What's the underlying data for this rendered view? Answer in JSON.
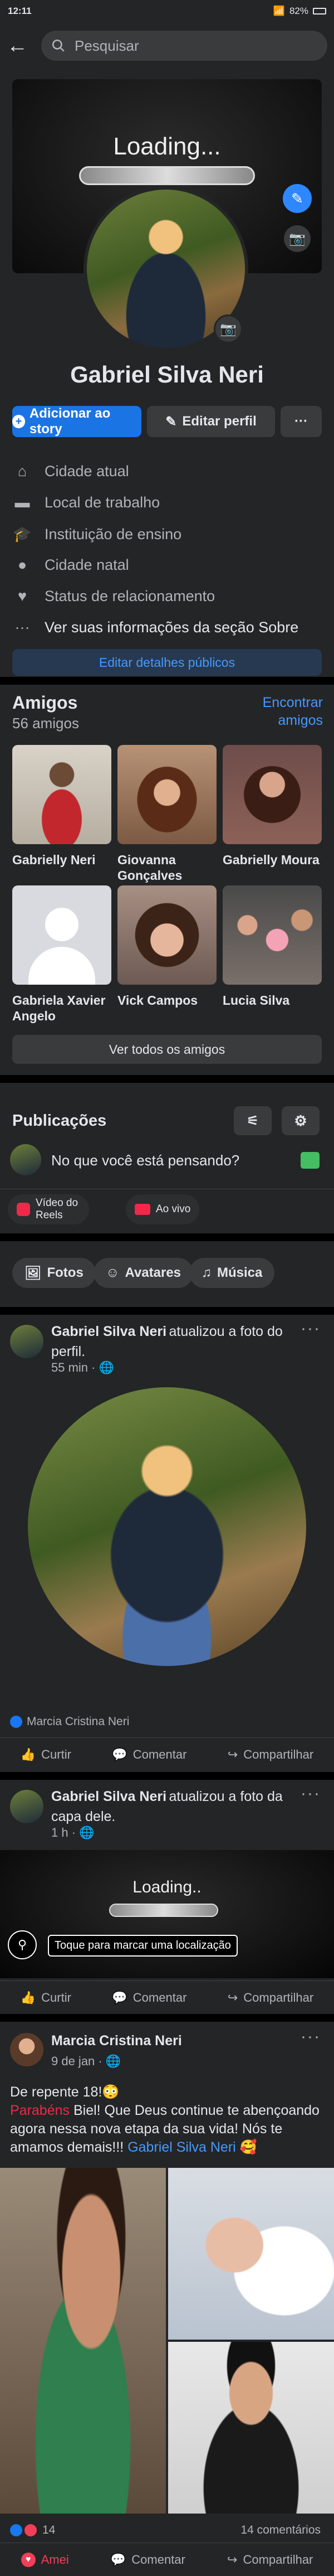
{
  "status": {
    "time": "12:11",
    "battery": "82%"
  },
  "search": {
    "placeholder": "Pesquisar"
  },
  "profile": {
    "cover_text": "Loading...",
    "name": "Gabriel Silva Neri",
    "add_story": "Adicionar ao story",
    "edit_profile": "Editar perfil",
    "more": "···"
  },
  "about": {
    "items": [
      "Cidade atual",
      "Local de trabalho",
      "Instituição de ensino",
      "Cidade natal",
      "Status de relacionamento"
    ],
    "see_more": "Ver suas informações da seção Sobre",
    "edit_public": "Editar detalhes públicos"
  },
  "friends": {
    "title": "Amigos",
    "count": "56 amigos",
    "find": "Encontrar amigos",
    "list": [
      "Gabrielly Neri",
      "Giovanna Gonçalves",
      "Gabrielly Moura",
      "Gabriela Xavier Angelo",
      "Vick Campos",
      "Lucia Silva"
    ],
    "see_all": "Ver todos os amigos"
  },
  "publications": {
    "title": "Publicações",
    "composer": "No que você está pensando?",
    "reels": "Vídeo do Reels",
    "live": "Ao vivo"
  },
  "filters": {
    "photos": "Fotos",
    "avatars": "Avatares",
    "music": "Música"
  },
  "posts": [
    {
      "author": "Gabriel Silva Neri",
      "action": "atualizou a foto do perfil.",
      "time": "55 min",
      "reactor": "Marcia Cristina Neri"
    },
    {
      "author": "Gabriel Silva Neri",
      "action": "atualizou a foto da capa dele.",
      "time": "1 h",
      "cover_text": "Loading..",
      "location_tip": "Toque para marcar uma localização"
    },
    {
      "author": "Marcia Cristina Neri",
      "time": "9 de jan",
      "text_1": "De repente 18!😳",
      "highlight": "Parabéns",
      "text_2": " Biel! Que Deus continue te abençoando agora nessa nova etapa da sua vida! Nós te amamos demais!!! ",
      "mention": "Gabriel Silva Neri",
      "emoji": " 🥰",
      "reactions": "14",
      "comments": "14 comentários"
    }
  ],
  "actions": {
    "like": "Curtir",
    "comment": "Comentar",
    "share": "Compartilhar",
    "loved": "Amei"
  },
  "colors": {
    "bg": "#18191a",
    "card": "#242526",
    "accent": "#2d88ff",
    "accent_btn": "#1b74e4",
    "muted": "#b0b3b8",
    "pill": "#3a3b3c"
  }
}
